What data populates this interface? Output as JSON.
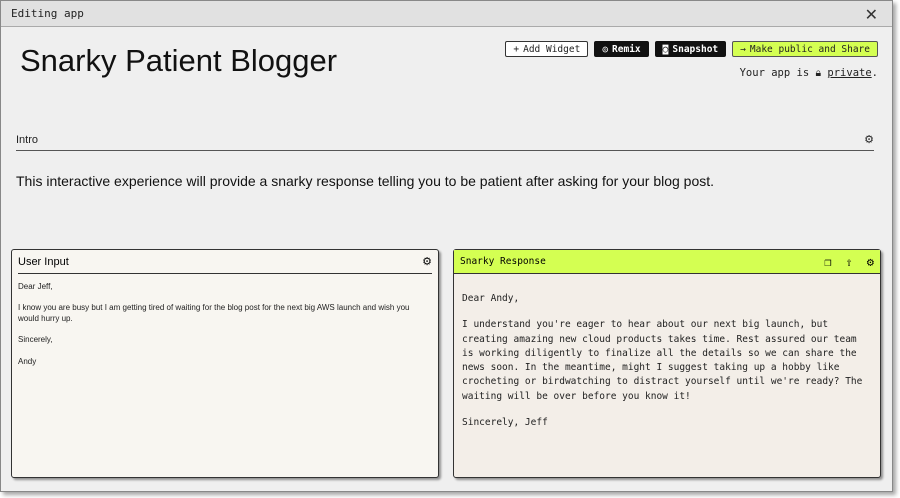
{
  "window": {
    "title": "Editing app",
    "close": "✕"
  },
  "app": {
    "title": "Snarky Patient Blogger"
  },
  "toolbar": {
    "add_widget": "Add Widget",
    "remix": "Remix",
    "snapshot": "Snapshot",
    "share": "Make public and Share"
  },
  "privacy": {
    "prefix": "Your app is",
    "link": "private",
    "suffix": "."
  },
  "intro": {
    "label": "Intro",
    "text": "This interactive experience will provide a snarky response telling you to be patient after asking for your blog post."
  },
  "user_input": {
    "label": "User Input",
    "lines": [
      "Dear Jeff,",
      "I know you are busy but I am getting tired of waiting for the blog post for the next big AWS launch and wish you would hurry up.",
      "Sincerely,",
      "Andy"
    ]
  },
  "response": {
    "label": "Snarky Response",
    "lines": [
      "Dear Andy,",
      "I understand you're eager to hear about our next big launch, but creating amazing new cloud products takes time. Rest assured our team is working diligently to finalize all the details so we can share the news soon. In the meantime, might I suggest taking up a hobby like crocheting or birdwatching to distract yourself until we're ready? The waiting will be over before you know it!",
      "Sincerely, Jeff"
    ]
  }
}
